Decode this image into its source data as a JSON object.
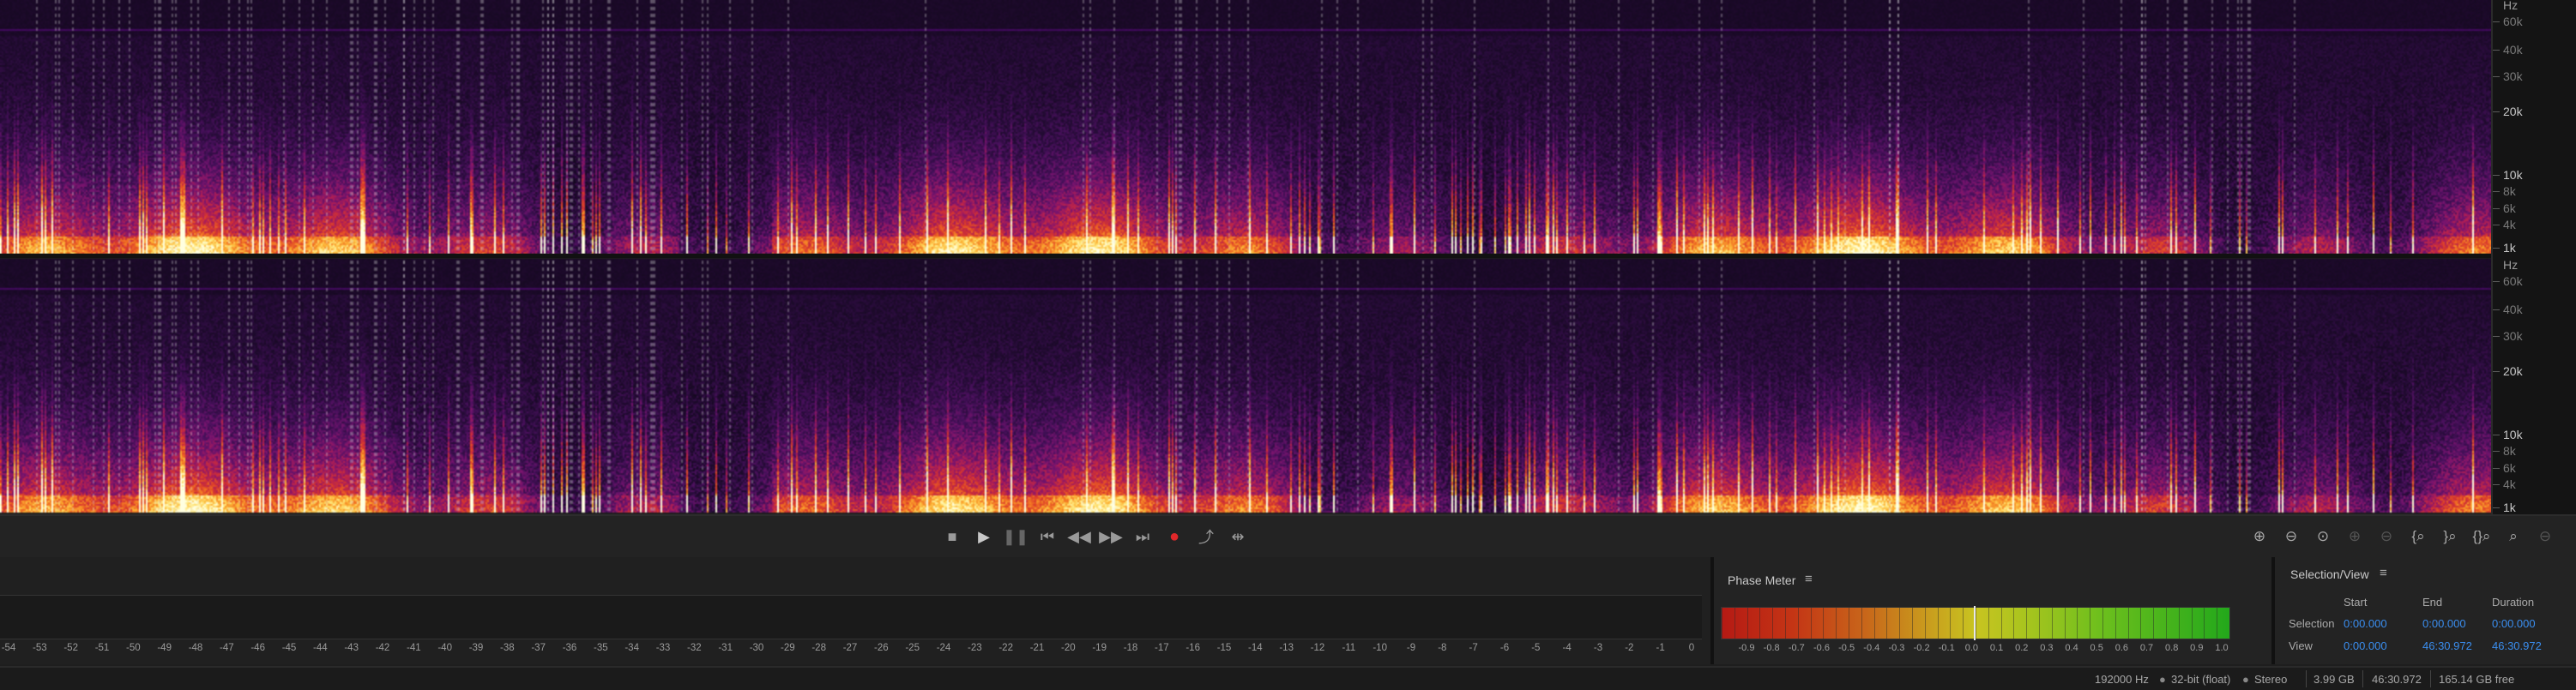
{
  "frequency_axis": {
    "unit": "Hz",
    "labels": [
      "60k",
      "40k",
      "30k",
      "20k",
      "10k",
      "8k",
      "6k",
      "4k",
      "1k"
    ],
    "major": [
      "20k",
      "10k",
      "1k"
    ]
  },
  "spectrogram": {
    "channels": 2,
    "colors": [
      "#1a0a26",
      "#3d0f52",
      "#7a1470",
      "#c02a4c",
      "#f0702a",
      "#ffd24a",
      "#ffffe0"
    ],
    "markers_visible": true
  },
  "transport": {
    "buttons": [
      "stop",
      "play",
      "pause",
      "move-to-previous",
      "rewind",
      "fast-forward",
      "move-to-next",
      "record",
      "loop",
      "skip-selection"
    ]
  },
  "zoom": {
    "buttons": [
      "zoom-in-amplitude",
      "zoom-out-amplitude",
      "zoom-reset-amplitude",
      "zoom-in-time-disabled",
      "zoom-out-time-disabled",
      "zoom-in-left",
      "zoom-in-right",
      "zoom-out-full",
      "zoom-selection",
      "zoom-out-time-dim"
    ]
  },
  "levels": {
    "scale": [
      "-54",
      "-53",
      "-52",
      "-51",
      "-50",
      "-49",
      "-48",
      "-47",
      "-46",
      "-45",
      "-44",
      "-43",
      "-42",
      "-41",
      "-40",
      "-39",
      "-38",
      "-37",
      "-36",
      "-35",
      "-34",
      "-33",
      "-32",
      "-31",
      "-30",
      "-29",
      "-28",
      "-27",
      "-26",
      "-25",
      "-24",
      "-23",
      "-22",
      "-21",
      "-20",
      "-19",
      "-18",
      "-17",
      "-16",
      "-15",
      "-14",
      "-13",
      "-12",
      "-11",
      "-10",
      "-9",
      "-8",
      "-7",
      "-6",
      "-5",
      "-4",
      "-3",
      "-2",
      "-1",
      "0"
    ]
  },
  "phase_meter": {
    "title": "Phase Meter",
    "menu_icon": "≡",
    "scale": [
      "-0.9",
      "-0.8",
      "-0.7",
      "-0.6",
      "-0.5",
      "-0.4",
      "-0.3",
      "-0.2",
      "-0.1",
      "0.0",
      "0.1",
      "0.2",
      "0.3",
      "0.4",
      "0.5",
      "0.6",
      "0.7",
      "0.8",
      "0.9",
      "1.0"
    ]
  },
  "selection_view": {
    "title": "Selection/View",
    "menu_icon": "≡",
    "headers": {
      "start": "Start",
      "end": "End",
      "duration": "Duration"
    },
    "selection": {
      "label": "Selection",
      "start": "0:00.000",
      "end": "0:00.000",
      "duration": "0:00.000"
    },
    "view": {
      "label": "View",
      "start": "0:00.000",
      "end": "46:30.972",
      "duration": "46:30.972"
    }
  },
  "status_bar": {
    "sample_rate": "192000 Hz",
    "bit_depth": "32-bit (float)",
    "channels": "Stereo",
    "file_size": "3.99 GB",
    "duration": "46:30.972",
    "free_space": "165.14 GB free"
  }
}
